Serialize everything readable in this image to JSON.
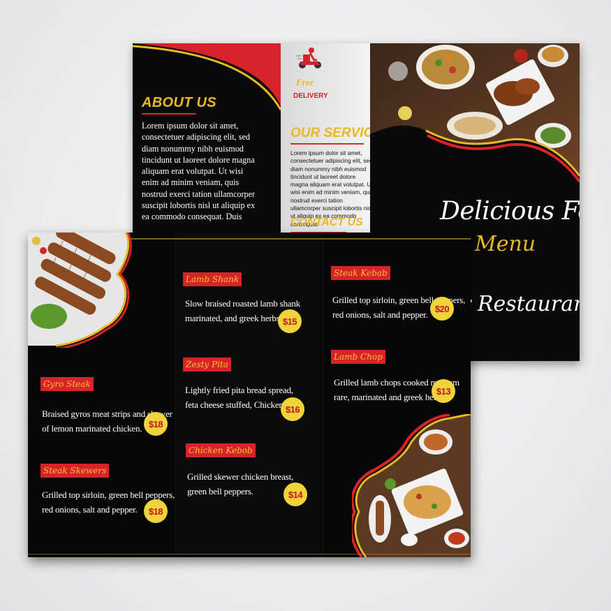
{
  "back": {
    "about": {
      "title": "ABOUT US",
      "body": "Lorem ipsum dolor sit amet, consectetuer adipiscing elit, sed diam nonummy nibh euismod tincidunt ut laoreet dolore magna aliquam erat volutpat. Ut wisi enim ad minim veniam, quis nostrud exerci tation ullamcorper suscipit lobortis nisl ut aliquip ex ea commodo consequat. Duis"
    },
    "delivery": {
      "free": "Free",
      "word": "DELIVERY"
    },
    "services": {
      "title": "OUR SERVICES",
      "body": "Lorem ipsum dolor sit amet, consectetuer adipiscing elit, sed diam nonummy nibh euismod tincidunt ut laoreet dolore magna aliquam erat volutpat. Ut wisi enim ad minim veniam, quis nostrud exerci tation ullamcorper suscipit lobortis nisl ut aliquip ex ea commodo consequat."
    },
    "contact": {
      "title": "CONTACT US"
    },
    "cover": {
      "line1": "Delicious Food",
      "line2": "Menu",
      "line3": "r Restaurant"
    }
  },
  "menu": {
    "col1": [
      {
        "name": "Gyro Steak",
        "desc": [
          "Braised gyros meat strips and skewer",
          "of lemon marinated chicken."
        ],
        "price": "$18"
      },
      {
        "name": "Steak Skewers",
        "desc": [
          "Grilled top sirloin, green bell peppers,",
          "red onions, salt and pepper."
        ],
        "price": "$18"
      }
    ],
    "col2": [
      {
        "name": "Lamb Shank",
        "desc": [
          "Slow braised roasted lamb shank",
          "marinated, and greek herbs."
        ],
        "price": "$15"
      },
      {
        "name": "Zesty Pita",
        "desc": [
          "Lightly fried pita bread spread,",
          "feta cheese stuffed, Chicken."
        ],
        "price": "$16"
      },
      {
        "name": "Chicken Kebob",
        "desc": [
          "Grilled skewer chicken breast,",
          "green bell peppers."
        ],
        "price": "$14"
      }
    ],
    "col3": [
      {
        "name": "Steak Kebab",
        "desc": [
          "Grilled top sirloin, green bell peppers,",
          "red onions, salt and pepper."
        ],
        "price": "$20"
      },
      {
        "name": "Lamb Chop",
        "desc": [
          "Grilled lamb chops cooked medium",
          "rare, marinated and greek herbs."
        ],
        "price": "$13"
      }
    ]
  },
  "colors": {
    "accent_red": "#d9232a",
    "accent_yellow": "#e8b923",
    "panel_black": "#0a0a0a"
  }
}
